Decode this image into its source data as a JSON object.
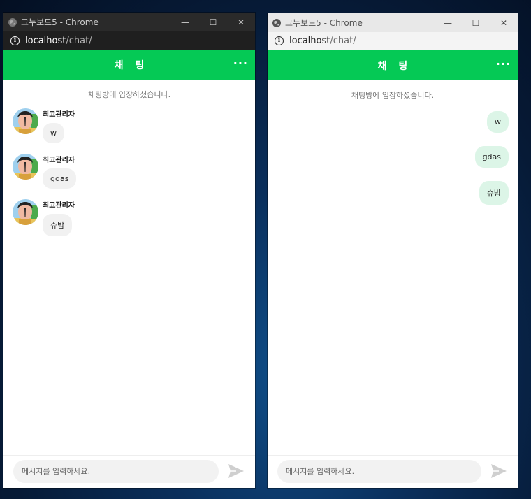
{
  "colors": {
    "brand_green": "#05c955",
    "bubble_out": "#dcf5e7",
    "bubble_in": "#f1f1f1"
  },
  "windows": [
    {
      "titlebar": {
        "title": "그누보드5 - Chrome",
        "icon": "globe-icon",
        "minimize": "—",
        "maximize": "☐",
        "close": "✕"
      },
      "address": {
        "host": "localhost",
        "path": "/chat/"
      },
      "header": {
        "title": "채 팅",
        "more": "···"
      },
      "system_message": "채팅방에 입장하셨습니다.",
      "messages": [
        {
          "sender": "최고관리자",
          "text": "w",
          "avatar": "user-avatar"
        },
        {
          "sender": "최고관리자",
          "text": "gdas",
          "avatar": "user-avatar"
        },
        {
          "sender": "최고관리자",
          "text": "슈밤",
          "avatar": "user-avatar"
        }
      ],
      "input": {
        "placeholder": "메시지를 입력하세요."
      },
      "send_icon": "send-icon"
    },
    {
      "titlebar": {
        "title": "그누보드5 - Chrome",
        "icon": "globe-icon",
        "minimize": "—",
        "maximize": "☐",
        "close": "✕"
      },
      "address": {
        "host": "localhost",
        "path": "/chat/"
      },
      "header": {
        "title": "채 팅",
        "more": "···"
      },
      "system_message": "채팅방에 입장하셨습니다.",
      "messages": [
        {
          "text": "w"
        },
        {
          "text": "gdas"
        },
        {
          "text": "슈밤"
        }
      ],
      "input": {
        "placeholder": "메시지를 입력하세요."
      },
      "send_icon": "send-icon"
    }
  ]
}
